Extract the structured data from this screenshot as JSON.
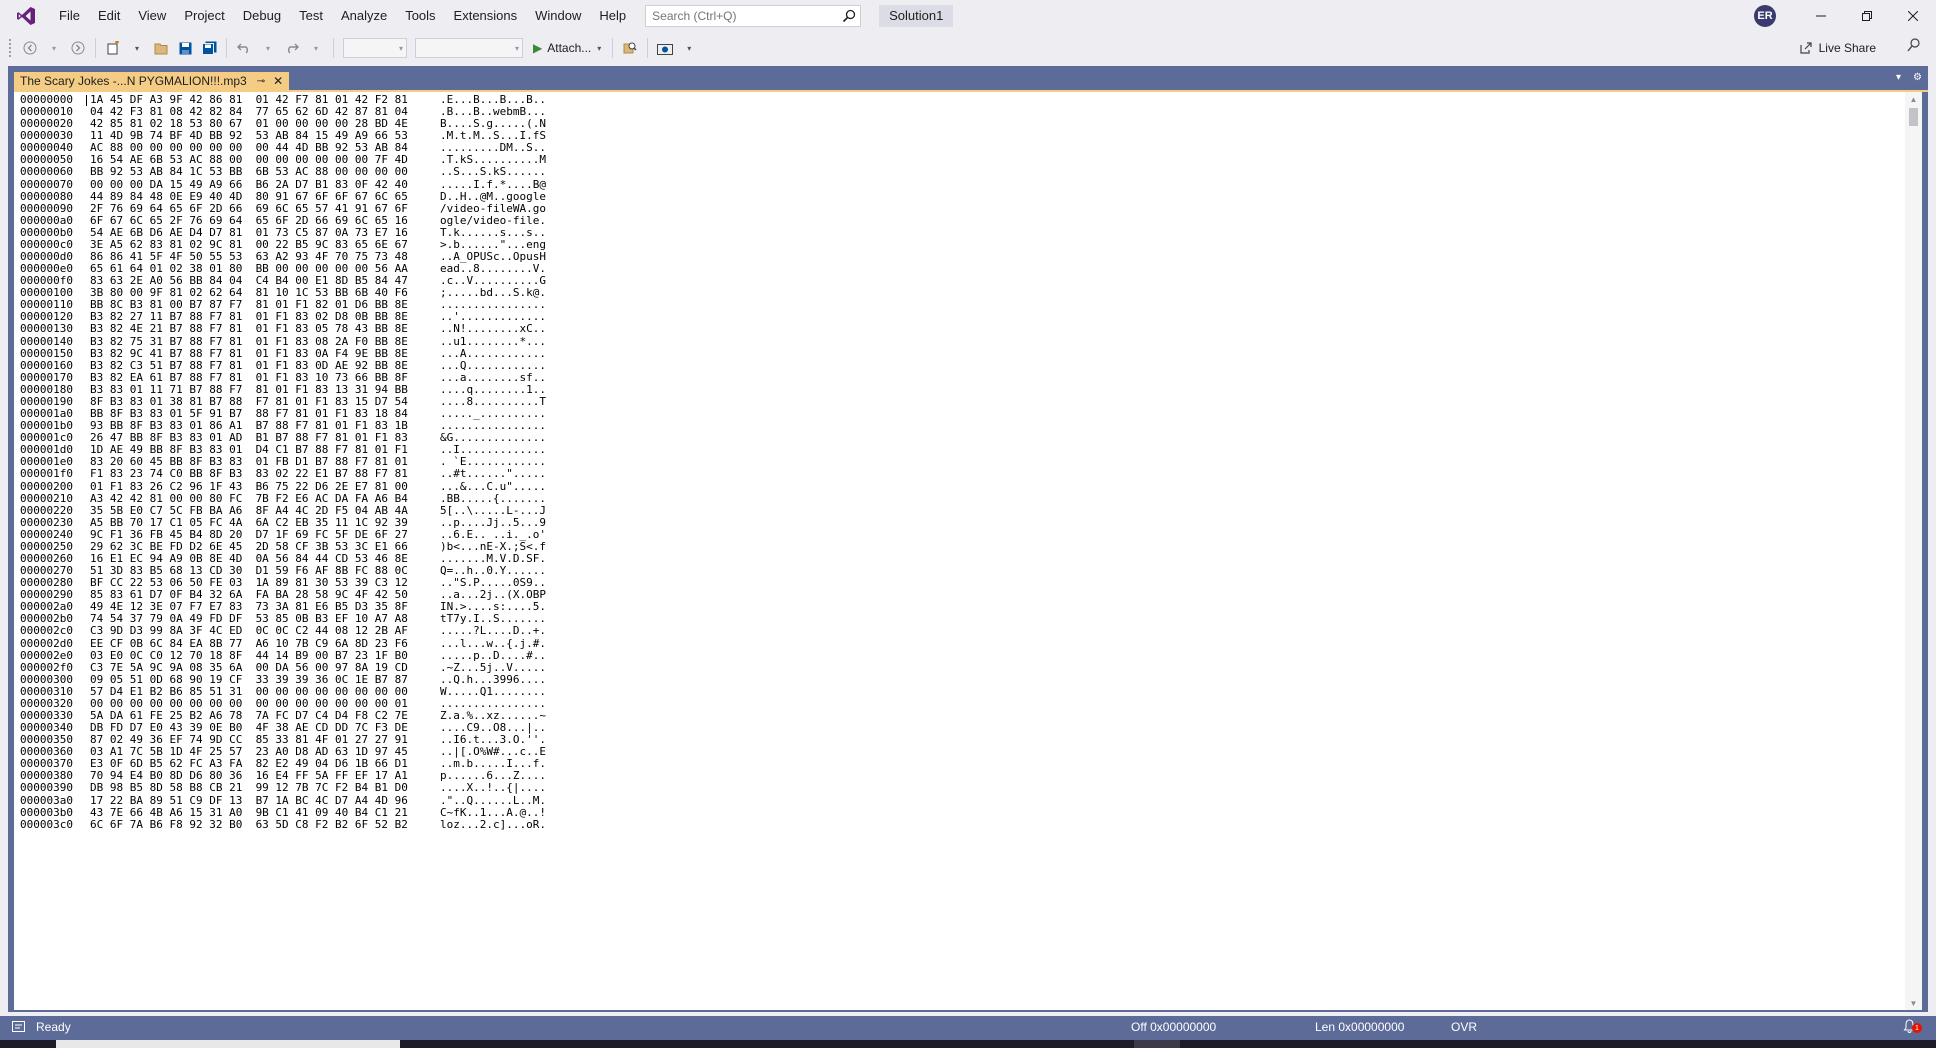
{
  "menu": {
    "items": [
      "File",
      "Edit",
      "View",
      "Project",
      "Debug",
      "Test",
      "Analyze",
      "Tools",
      "Extensions",
      "Window",
      "Help"
    ]
  },
  "search": {
    "placeholder": "Search (Ctrl+Q)"
  },
  "solution_name": "Solution1",
  "user": {
    "initials": "ER"
  },
  "toolbar": {
    "attach_label": "Attach...",
    "liveshare_label": "Live Share"
  },
  "document_tab": {
    "title": "The Scary Jokes -...N PYGMALION!!!.mp3"
  },
  "hex": {
    "rows": [
      [
        "00000000",
        "1A 45 DF A3 9F 42 86 81  01 42 F7 81 01 42 F2 81",
        ".E...B...B...B.."
      ],
      [
        "00000010",
        "04 42 F3 81 08 42 82 84  77 65 62 6D 42 87 81 04",
        ".B...B..webmB..."
      ],
      [
        "00000020",
        "42 85 81 02 18 53 80 67  01 00 00 00 00 28 BD 4E",
        "B....S.g.....(.N"
      ],
      [
        "00000030",
        "11 4D 9B 74 BF 4D BB 92  53 AB 84 15 49 A9 66 53",
        ".M.t.M..S...I.fS"
      ],
      [
        "00000040",
        "AC 88 00 00 00 00 00 00  00 44 4D BB 92 53 AB 84",
        ".........DM..S.."
      ],
      [
        "00000050",
        "16 54 AE 6B 53 AC 88 00  00 00 00 00 00 00 7F 4D",
        ".T.kS..........M"
      ],
      [
        "00000060",
        "BB 92 53 AB 84 1C 53 BB  6B 53 AC 88 00 00 00 00",
        "..S...S.kS......"
      ],
      [
        "00000070",
        "00 00 00 DA 15 49 A9 66  B6 2A D7 B1 83 0F 42 40",
        ".....I.f.*....B@"
      ],
      [
        "00000080",
        "44 89 84 48 0E E9 40 4D  80 91 67 6F 6F 67 6C 65",
        "D..H..@M..google"
      ],
      [
        "00000090",
        "2F 76 69 64 65 6F 2D 66  69 6C 65 57 41 91 67 6F",
        "/video-fileWA.go"
      ],
      [
        "000000a0",
        "6F 67 6C 65 2F 76 69 64  65 6F 2D 66 69 6C 65 16",
        "ogle/video-file."
      ],
      [
        "000000b0",
        "54 AE 6B D6 AE D4 D7 81  01 73 C5 87 0A 73 E7 16",
        "T.k......s...s.."
      ],
      [
        "000000c0",
        "3E A5 62 83 81 02 9C 81  00 22 B5 9C 83 65 6E 67",
        ">.b......\"...eng"
      ],
      [
        "000000d0",
        "86 86 41 5F 4F 50 55 53  63 A2 93 4F 70 75 73 48",
        "..A_OPUSc..OpusH"
      ],
      [
        "000000e0",
        "65 61 64 01 02 38 01 80  BB 00 00 00 00 00 56 AA",
        "ead..8........V."
      ],
      [
        "000000f0",
        "83 63 2E A0 56 BB 84 04  C4 B4 00 E1 8D B5 84 47",
        ".c..V..........G"
      ],
      [
        "00000100",
        "3B 80 00 9F 81 02 62 64  81 10 1C 53 BB 6B 40 F6",
        ";.....bd...S.k@."
      ],
      [
        "00000110",
        "BB 8C B3 81 00 B7 87 F7  81 01 F1 82 01 D6 BB 8E",
        "................"
      ],
      [
        "00000120",
        "B3 82 27 11 B7 88 F7 81  01 F1 83 02 D8 0B BB 8E",
        "..'............."
      ],
      [
        "00000130",
        "B3 82 4E 21 B7 88 F7 81  01 F1 83 05 78 43 BB 8E",
        "..N!........xC.."
      ],
      [
        "00000140",
        "B3 82 75 31 B7 88 F7 81  01 F1 83 08 2A F0 BB 8E",
        "..u1........*..."
      ],
      [
        "00000150",
        "B3 82 9C 41 B7 88 F7 81  01 F1 83 0A F4 9E BB 8E",
        "...A............"
      ],
      [
        "00000160",
        "B3 82 C3 51 B7 88 F7 81  01 F1 83 0D AE 92 BB 8E",
        "...Q............"
      ],
      [
        "00000170",
        "B3 82 EA 61 B7 88 F7 81  01 F1 83 10 73 66 BB 8F",
        "...a........sf.."
      ],
      [
        "00000180",
        "B3 83 01 11 71 B7 88 F7  81 01 F1 83 13 31 94 BB",
        "....q........1.."
      ],
      [
        "00000190",
        "8F B3 83 01 38 81 B7 88  F7 81 01 F1 83 15 D7 54",
        "....8..........T"
      ],
      [
        "000001a0",
        "BB 8F B3 83 01 5F 91 B7  88 F7 81 01 F1 83 18 84",
        "....._.........."
      ],
      [
        "000001b0",
        "93 BB 8F B3 83 01 86 A1  B7 88 F7 81 01 F1 83 1B",
        "................"
      ],
      [
        "000001c0",
        "26 47 BB 8F B3 83 01 AD  B1 B7 88 F7 81 01 F1 83",
        "&G.............."
      ],
      [
        "000001d0",
        "1D AE 49 BB 8F B3 83 01  D4 C1 B7 88 F7 81 01 F1",
        "..I............."
      ],
      [
        "000001e0",
        "83 20 60 45 BB 8F B3 83  01 FB D1 B7 88 F7 81 01",
        ". `E............"
      ],
      [
        "000001f0",
        "F1 83 23 74 C0 BB 8F B3  83 02 22 E1 B7 88 F7 81",
        "..#t......\"....."
      ],
      [
        "00000200",
        "01 F1 83 26 C2 96 1F 43  B6 75 22 D6 2E E7 81 00",
        "...&...C.u\"....."
      ],
      [
        "00000210",
        "A3 42 42 81 00 00 80 FC  7B F2 E6 AC DA FA A6 B4",
        ".BB.....{......."
      ],
      [
        "00000220",
        "35 5B E0 C7 5C FB BA A6  8F A4 4C 2D F5 04 AB 4A",
        "5[..\\.....L-...J"
      ],
      [
        "00000230",
        "A5 BB 70 17 C1 05 FC 4A  6A C2 EB 35 11 1C 92 39",
        "..p....Jj..5...9"
      ],
      [
        "00000240",
        "9C F1 36 FB 45 B4 8D 20  D7 1F 69 FC 5F DE 6F 27",
        "..6.E.. ..i._.o'"
      ],
      [
        "00000250",
        "29 62 3C BE FD D2 6E 45  2D 58 CF 3B 53 3C E1 66",
        ")b<...nE-X.;S<.f"
      ],
      [
        "00000260",
        "16 E1 EC 94 A9 0B 8E 4D  0A 56 84 44 CD 53 46 8E",
        ".......M.V.D.SF."
      ],
      [
        "00000270",
        "51 3D 83 B5 68 13 CD 30  D1 59 F6 AF 8B FC 88 0C",
        "Q=..h..0.Y......"
      ],
      [
        "00000280",
        "BF CC 22 53 06 50 FE 03  1A 89 81 30 53 39 C3 12",
        "..\"S.P.....0S9.."
      ],
      [
        "00000290",
        "85 83 61 D7 0F B4 32 6A  FA BA 28 58 9C 4F 42 50",
        "..a...2j..(X.OBP"
      ],
      [
        "000002a0",
        "49 4E 12 3E 07 F7 E7 83  73 3A 81 E6 B5 D3 35 8F",
        "IN.>....s:....5."
      ],
      [
        "000002b0",
        "74 54 37 79 0A 49 FD DF  53 85 0B B3 EF 10 A7 A8",
        "tT7y.I..S......."
      ],
      [
        "000002c0",
        "C3 9D D3 99 8A 3F 4C ED  0C 0C C2 44 08 12 2B AF",
        ".....?L....D..+."
      ],
      [
        "000002d0",
        "EE CF 0B 6C 84 EA 8B 77  A6 10 7B C9 6A 8D 23 F6",
        "...l...w..{.j.#."
      ],
      [
        "000002e0",
        "03 E0 0C C0 12 70 18 8F  44 14 B9 00 B7 23 1F B0",
        ".....p..D....#.."
      ],
      [
        "000002f0",
        "C3 7E 5A 9C 9A 08 35 6A  00 DA 56 00 97 8A 19 CD",
        ".~Z...5j..V....."
      ],
      [
        "00000300",
        "09 05 51 0D 68 90 19 CF  33 39 39 36 0C 1E B7 87",
        "..Q.h...3996...."
      ],
      [
        "00000310",
        "57 D4 E1 B2 B6 85 51 31  00 00 00 00 00 00 00 00",
        "W.....Q1........"
      ],
      [
        "00000320",
        "00 00 00 00 00 00 00 00  00 00 00 00 00 00 00 01",
        "................"
      ],
      [
        "00000330",
        "5A DA 61 FE 25 B2 A6 78  7A FC D7 C4 D4 F8 C2 7E",
        "Z.a.%..xz......~"
      ],
      [
        "00000340",
        "DB FD D7 E0 43 39 0E B0  4F 38 AE CD DD 7C F3 DE",
        "....C9..O8...|.."
      ],
      [
        "00000350",
        "87 02 49 36 EF 74 9D CC  85 33 81 4F 01 27 27 91",
        "..I6.t...3.O.''."
      ],
      [
        "00000360",
        "03 A1 7C 5B 1D 4F 25 57  23 A0 D8 AD 63 1D 97 45",
        "..|[.O%W#...c..E"
      ],
      [
        "00000370",
        "E3 0F 6D B5 62 FC A3 FA  82 E2 49 04 D6 1B 66 D1",
        "..m.b.....I...f."
      ],
      [
        "00000380",
        "70 94 E4 B0 8D D6 80 36  16 E4 FF 5A FF EF 17 A1",
        "p......6...Z...."
      ],
      [
        "00000390",
        "DB 98 B5 8D 58 B8 CB 21  99 12 7B 7C F2 B4 B1 D0",
        "....X..!..{|...."
      ],
      [
        "000003a0",
        "17 22 BA 89 51 C9 DF 13  B7 1A BC 4C D7 A4 4D 96",
        ".\"..Q......L..M."
      ],
      [
        "000003b0",
        "43 7E 66 4B A6 15 31 A0  9B C1 41 09 40 B4 C1 21",
        "C~fK..1...A.@..!"
      ],
      [
        "000003c0",
        "6C 6F 7A B6 F8 92 32 B0  63 5D C8 F2 B2 6F 52 B2",
        "loz...2.c]...oR."
      ]
    ]
  },
  "status": {
    "ready": "Ready",
    "offset": "Off 0x00000000",
    "length": "Len 0x00000000",
    "mode": "OVR"
  },
  "icons": {
    "logo": "visual-studio-logo-icon",
    "search": "search-icon",
    "status": "status-icon",
    "notifications": "bell-icon"
  },
  "colors": {
    "chrome_bg": "#eeeef2",
    "frame_blue": "#5d6b99",
    "active_tab": "#f5cc84",
    "vs_purple": "#68217a",
    "play_green": "#388a34"
  }
}
